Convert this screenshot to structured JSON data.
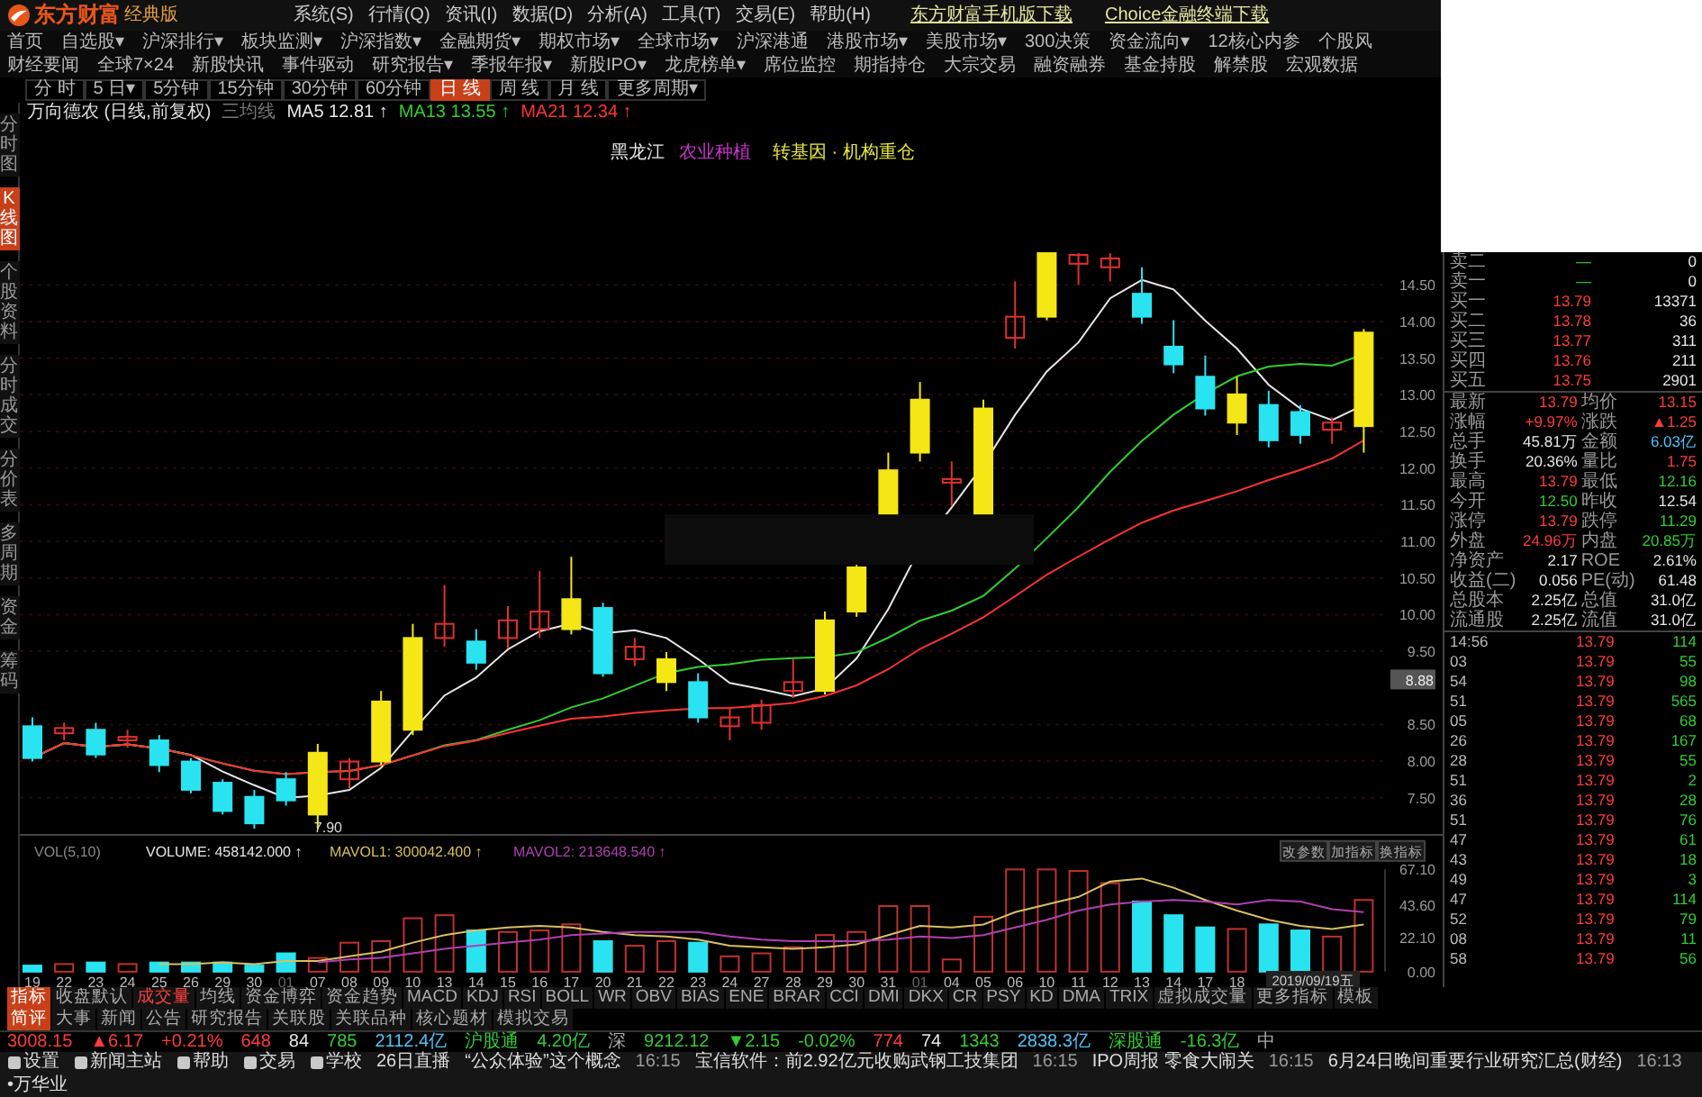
{
  "app": {
    "logo": "东方财富",
    "edition": "经典版",
    "menu": [
      "系统(S)",
      "行情(Q)",
      "资讯(I)",
      "数据(D)",
      "分析(A)",
      "工具(T)",
      "交易(E)",
      "帮助(H)"
    ],
    "links": [
      "东方财富手机版下载",
      "Choice金融终端下载"
    ]
  },
  "nav_rows": [
    [
      "首页",
      "自选股▾",
      "沪深排行▾",
      "板块监测▾",
      "沪深指数▾",
      "金融期货▾",
      "期权市场▾",
      "全球市场▾",
      "沪深港通",
      "港股市场▾",
      "美股市场▾",
      "300决策",
      "资金流向▾",
      "12核心内参",
      "个股风"
    ],
    [
      "财经要闻",
      "全球7×24",
      "新股快讯",
      "事件驱动",
      "研究报告▾",
      "季报年报▾",
      "新股IPO▾",
      "龙虎榜单▾",
      "席位监控",
      "期指持仓",
      "大宗交易",
      "融资融券",
      "基金持股",
      "解禁股",
      "宏观数据"
    ]
  ],
  "periods": [
    {
      "label": "分 时",
      "selected": false
    },
    {
      "label": "5 日▾",
      "selected": false
    },
    {
      "label": "5分钟",
      "selected": false
    },
    {
      "label": "15分钟",
      "selected": false
    },
    {
      "label": "30分钟",
      "selected": false
    },
    {
      "label": "60分钟",
      "selected": false
    },
    {
      "label": "日 线",
      "selected": true
    },
    {
      "label": "周 线",
      "selected": false
    },
    {
      "label": "月 线",
      "selected": false
    },
    {
      "label": "更多周期▾",
      "selected": false
    }
  ],
  "side_tabs": [
    {
      "label": "分时图",
      "selected": false
    },
    {
      "label": "K线图",
      "selected": true
    },
    {
      "label": "个股资料",
      "selected": false
    },
    {
      "label": "分时成交",
      "selected": false
    },
    {
      "label": "分价表",
      "selected": false
    },
    {
      "label": "多周期",
      "selected": false
    },
    {
      "label": "资金",
      "selected": false
    },
    {
      "label": "筹码",
      "selected": false
    }
  ],
  "chart": {
    "title": "万向德农",
    "subtitle": "(日线,前复权)",
    "template": "三均线",
    "ma": [
      {
        "label": "MA5",
        "value": "12.81 ↑",
        "color": "#e6e6e6"
      },
      {
        "label": "MA13",
        "value": "13.55 ↑",
        "color": "#33cc33"
      },
      {
        "label": "MA21",
        "value": "12.34 ↑",
        "color": "#ff3333"
      }
    ],
    "tags": [
      {
        "text": "黑龙江",
        "color": "#e6e6e6"
      },
      {
        "text": "农业种植",
        "color": "#cc33cc"
      },
      {
        "text": "转基因 · 机构重仓",
        "color": "#e6e640"
      }
    ],
    "price_ticks": [
      "14.50",
      "14.00",
      "13.50",
      "13.00",
      "12.50",
      "12.00",
      "11.50",
      "11.00",
      "10.50",
      "10.00",
      "9.50",
      "8.50",
      "8.00",
      "7.50"
    ],
    "price_marker": "8.88",
    "low_label": "7.90",
    "volume_label": "VOL(5,10)",
    "volume_values": [
      ": 458142.000 ↑",
      ": 300042.400 ↑",
      ": 213648.540 ↑"
    ],
    "volume_buttons": [
      "改参数",
      "加指标",
      "换指标"
    ],
    "date_dim": [
      false,
      false,
      false,
      false,
      false,
      false,
      false,
      false,
      true,
      false,
      false,
      false,
      false,
      false,
      false,
      false,
      false,
      false,
      false,
      false,
      false,
      false,
      false,
      false,
      false,
      false,
      false,
      false,
      true,
      false,
      false,
      false,
      false,
      false,
      false,
      false,
      false,
      false,
      false
    ],
    "chart_data": {
      "type": "bar",
      "stacked": false,
      "ylim": [
        0,
        67.1
      ],
      "yticks": [
        {
          "value": 67.1,
          "label": "67.10"
        },
        {
          "value": 43.6,
          "label": "43.60"
        },
        {
          "value": 22.1,
          "label": "22.10"
        },
        {
          "value": 0,
          "label": "0.00"
        }
      ],
      "categories": [
        "19",
        "22",
        "23",
        "24",
        "25",
        "26",
        "29",
        "30",
        "01",
        "07",
        "08",
        "09",
        "10",
        "13",
        "14",
        "15",
        "16",
        "17",
        "20",
        "21",
        "22",
        "23",
        "24",
        "27",
        "28",
        "29",
        "30",
        "31",
        "01",
        "04",
        "05",
        "06",
        "10",
        "11",
        "12",
        "13",
        "14",
        "17",
        "18",
        null,
        null,
        null,
        null
      ],
      "series": [
        {
          "name": "VOLUME",
          "colors": [
            "#29e3f0",
            "#c03030",
            "#29e3f0",
            "#c03030",
            "#29e3f0",
            "#29e3f0",
            "#29e3f0",
            "#29e3f0",
            "#29e3f0",
            "#c03030",
            "#c03030",
            "#c03030",
            "#c03030",
            "#c03030",
            "#29e3f0",
            "#c03030",
            "#c03030",
            "#c03030",
            "#29e3f0",
            "#c03030",
            "#c03030",
            "#29e3f0",
            "#c03030",
            "#c03030",
            "#c03030",
            "#c03030",
            "#c03030",
            "#c03030",
            "#c03030",
            "#c03030",
            "#c03030",
            "#c03030",
            "#c03030",
            "#c03030",
            "#c03030",
            "#29e3f0",
            "#29e3f0",
            "#29e3f0",
            "#c03030",
            "#29e3f0",
            "#29e3f0",
            "#c03030",
            "#c03030"
          ],
          "values": [
            4,
            5,
            6,
            5,
            6,
            6,
            6,
            4,
            12,
            9,
            19,
            20,
            35,
            37,
            27,
            26,
            27,
            31,
            20,
            17,
            20,
            19,
            10,
            12,
            16,
            24,
            26,
            43,
            43,
            8,
            36,
            67,
            67,
            66,
            58,
            46,
            37,
            29,
            28,
            31,
            27,
            23,
            47
          ]
        },
        {
          "name": "MAVOL1",
          "type": "line",
          "color": "#d8c060",
          "values": [
            null,
            null,
            null,
            null,
            5,
            5,
            6,
            5,
            7,
            7,
            10,
            13,
            19,
            24,
            27,
            29,
            30,
            29,
            26,
            24,
            23,
            21,
            17,
            16,
            15,
            16,
            18,
            24,
            30,
            29,
            31,
            39,
            44,
            49,
            59,
            61,
            55,
            47,
            40,
            34,
            30,
            28,
            31
          ]
        },
        {
          "name": "MAVOL2",
          "type": "line",
          "color": "#b040b0",
          "values": [
            null,
            null,
            null,
            null,
            null,
            null,
            null,
            null,
            null,
            6,
            8,
            9,
            12,
            15,
            17,
            19,
            21,
            24,
            25,
            26,
            26,
            26,
            23,
            21,
            20,
            20,
            20,
            21,
            23,
            22,
            24,
            29,
            34,
            40,
            44,
            46,
            47,
            46,
            44,
            47,
            46,
            41,
            39
          ]
        }
      ]
    },
    "date_box": "2019/09/19五"
  },
  "order_book": [
    {
      "label": "卖二",
      "price": "—",
      "volume": "0"
    },
    {
      "label": "卖一",
      "price": "—",
      "volume": "0"
    },
    {
      "label": "买一",
      "price": "13.79",
      "volume": "13371"
    },
    {
      "label": "买二",
      "price": "13.78",
      "volume": "36"
    },
    {
      "label": "买三",
      "price": "13.77",
      "volume": "311"
    },
    {
      "label": "买四",
      "price": "13.76",
      "volume": "211"
    },
    {
      "label": "买五",
      "price": "13.75",
      "volume": "2901"
    }
  ],
  "stats": [
    {
      "label": "最新",
      "value": "13.79",
      "color": "#ff3b3b"
    },
    {
      "label": "均价",
      "value": "13.15",
      "color": "#ff3b3b"
    },
    {
      "label": "涨幅",
      "value": "+9.97%",
      "color": "#ff3b3b"
    },
    {
      "label": "涨跌",
      "value": "▲1.25",
      "color": "#ff3b3b"
    },
    {
      "label": "总手",
      "value": "45.81万",
      "color": "#e6e6e6"
    },
    {
      "label": "金额",
      "value": "6.03亿",
      "color": "#4fc3f7"
    },
    {
      "label": "换手",
      "value": "20.36%",
      "color": "#e6e6e6"
    },
    {
      "label": "量比",
      "value": "1.75",
      "color": "#ff3b3b"
    },
    {
      "label": "最高",
      "value": "13.79",
      "color": "#ff3b3b"
    },
    {
      "label": "最低",
      "value": "12.16",
      "color": "#33cc33"
    },
    {
      "label": "今开",
      "value": "12.50",
      "color": "#33cc33"
    },
    {
      "label": "昨收",
      "value": "12.54",
      "color": "#e6e6e6"
    },
    {
      "label": "涨停",
      "value": "13.79",
      "color": "#ff3b3b"
    },
    {
      "label": "跌停",
      "value": "11.29",
      "color": "#33cc33"
    },
    {
      "label": "外盘",
      "value": "24.96万",
      "color": "#ff3b3b"
    },
    {
      "label": "内盘",
      "value": "20.85万",
      "color": "#33cc33"
    },
    {
      "label": "净资产",
      "value": "2.17",
      "color": "#e6e6e6"
    },
    {
      "label": "ROE",
      "value": "2.61%",
      "color": "#e6e6e6"
    },
    {
      "label": "收益(二)",
      "value": "0.056",
      "color": "#e6e6e6"
    },
    {
      "label": "PE(动)",
      "value": "61.48",
      "color": "#e6e6e6"
    },
    {
      "label": "总股本",
      "value": "2.25亿",
      "color": "#e6e6e6"
    },
    {
      "label": "总值",
      "value": "31.0亿",
      "color": "#e6e6e6"
    },
    {
      "label": "流通股",
      "value": "2.25亿",
      "color": "#e6e6e6"
    },
    {
      "label": "流值",
      "value": "31.0亿",
      "color": "#e6e6e6"
    }
  ],
  "trades": [
    {
      "time": "14:56",
      "price": "13.79",
      "volume": "114"
    },
    {
      "time": "03",
      "price": "13.79",
      "volume": "55"
    },
    {
      "time": "54",
      "price": "13.79",
      "volume": "98"
    },
    {
      "time": "51",
      "price": "13.79",
      "volume": "565"
    },
    {
      "time": "05",
      "price": "13.79",
      "volume": "68"
    },
    {
      "time": "26",
      "price": "13.79",
      "volume": "167"
    },
    {
      "time": "28",
      "price": "13.79",
      "volume": "55"
    },
    {
      "time": "51",
      "price": "13.79",
      "volume": "2"
    },
    {
      "time": "36",
      "price": "13.79",
      "volume": "28"
    },
    {
      "time": "51",
      "price": "13.79",
      "volume": "76"
    },
    {
      "time": "47",
      "price": "13.79",
      "volume": "61"
    },
    {
      "time": "43",
      "price": "13.79",
      "volume": "18"
    },
    {
      "time": "49",
      "price": "13.79",
      "volume": "3"
    },
    {
      "time": "47",
      "price": "13.79",
      "volume": "114"
    },
    {
      "time": "52",
      "price": "13.79",
      "volume": "79"
    },
    {
      "time": "08",
      "price": "13.79",
      "volume": "11"
    },
    {
      "time": "58",
      "price": "13.79",
      "volume": "56"
    }
  ],
  "indicator_tabs": [
    {
      "label": "指标",
      "kind": "heading"
    },
    {
      "label": "收盘默认",
      "kind": "tab",
      "selected": false
    },
    {
      "label": "成交量",
      "kind": "tab",
      "selected": true
    },
    {
      "label": "均线",
      "kind": "tab",
      "selected": false
    },
    {
      "label": "资金博弈",
      "kind": "tab",
      "selected": false
    },
    {
      "label": "资金趋势",
      "kind": "tab",
      "selected": false
    },
    {
      "label": "MACD",
      "kind": "tab",
      "selected": false
    },
    {
      "label": "KDJ",
      "kind": "tab",
      "selected": false
    },
    {
      "label": "RSI",
      "kind": "tab",
      "selected": false
    },
    {
      "label": "BOLL",
      "kind": "tab",
      "selected": false
    },
    {
      "label": "WR",
      "kind": "tab",
      "selected": false
    },
    {
      "label": "OBV",
      "kind": "tab",
      "selected": false
    },
    {
      "label": "BIAS",
      "kind": "tab",
      "selected": false
    },
    {
      "label": "ENE",
      "kind": "tab",
      "selected": false
    },
    {
      "label": "BRAR",
      "kind": "tab",
      "selected": false
    },
    {
      "label": "CCI",
      "kind": "tab",
      "selected": false
    },
    {
      "label": "DMI",
      "kind": "tab",
      "selected": false
    },
    {
      "label": "DKX",
      "kind": "tab",
      "selected": false
    },
    {
      "label": "CR",
      "kind": "tab",
      "selected": false
    },
    {
      "label": "PSY",
      "kind": "tab",
      "selected": false
    },
    {
      "label": "KD",
      "kind": "tab",
      "selected": false
    },
    {
      "label": "DMA",
      "kind": "tab",
      "selected": false
    },
    {
      "label": "TRIX",
      "kind": "tab",
      "selected": false
    },
    {
      "label": "虚拟成交量",
      "kind": "tab",
      "selected": false
    },
    {
      "label": "更多指标",
      "kind": "tab",
      "selected": false
    },
    {
      "label": "模板",
      "kind": "tab",
      "selected": false
    }
  ],
  "info_tabs": [
    {
      "label": "简评",
      "selected": true
    },
    {
      "label": "大事",
      "selected": false
    },
    {
      "label": "新闻",
      "selected": false
    },
    {
      "label": "公告",
      "selected": false
    },
    {
      "label": "研究报告",
      "selected": false
    },
    {
      "label": "关联股",
      "selected": false
    },
    {
      "label": "关联品种",
      "selected": false
    },
    {
      "label": "核心题材",
      "selected": false
    },
    {
      "label": "模拟交易",
      "selected": false
    }
  ],
  "index_ticker": [
    {
      "text": "3008.15",
      "color": "#ff3b3b"
    },
    {
      "text": "▲6.17",
      "color": "#ff3b3b"
    },
    {
      "text": "+0.21%",
      "color": "#ff3b3b"
    },
    {
      "text": "648",
      "color": "#ff3b3b"
    },
    {
      "text": "84",
      "color": "#e6e6e6"
    },
    {
      "text": "785",
      "color": "#33cc33"
    },
    {
      "text": "2112.4亿",
      "color": "#4fc3f7"
    },
    {
      "text": "沪股通",
      "color": "#33cc33"
    },
    {
      "text": "4.20亿",
      "color": "#33cc33"
    },
    {
      "text": "深",
      "color": "#aaaaaa"
    },
    {
      "text": "9212.12",
      "color": "#33cc33"
    },
    {
      "text": "▼2.15",
      "color": "#33cc33"
    },
    {
      "text": "-0.02%",
      "color": "#33cc33"
    },
    {
      "text": "774",
      "color": "#ff3b3b"
    },
    {
      "text": "74",
      "color": "#e6e6e6"
    },
    {
      "text": "1343",
      "color": "#33cc33"
    },
    {
      "text": "2838.3亿",
      "color": "#4fc3f7"
    },
    {
      "text": "深股通",
      "color": "#33cc33"
    },
    {
      "text": "-16.3亿",
      "color": "#33cc33"
    },
    {
      "text": "中",
      "color": "#aaaaaa"
    }
  ],
  "shortcuts": [
    "设置",
    "新闻主站",
    "帮助",
    "交易",
    "学校"
  ],
  "news": [
    {
      "text": "26日直播"
    },
    {
      "text": "“公众体验”这个概念"
    },
    {
      "time": "16:15",
      "text": "宝信软件：前2.92亿元收购武钢工技集团"
    },
    {
      "time": "16:15",
      "text": "IPO周报 零食大闹关"
    },
    {
      "time": "16:15",
      "text": "6月24日晚间重要行业研究汇总(财经)"
    },
    {
      "time": "16:13",
      "text": "•万华业"
    }
  ]
}
